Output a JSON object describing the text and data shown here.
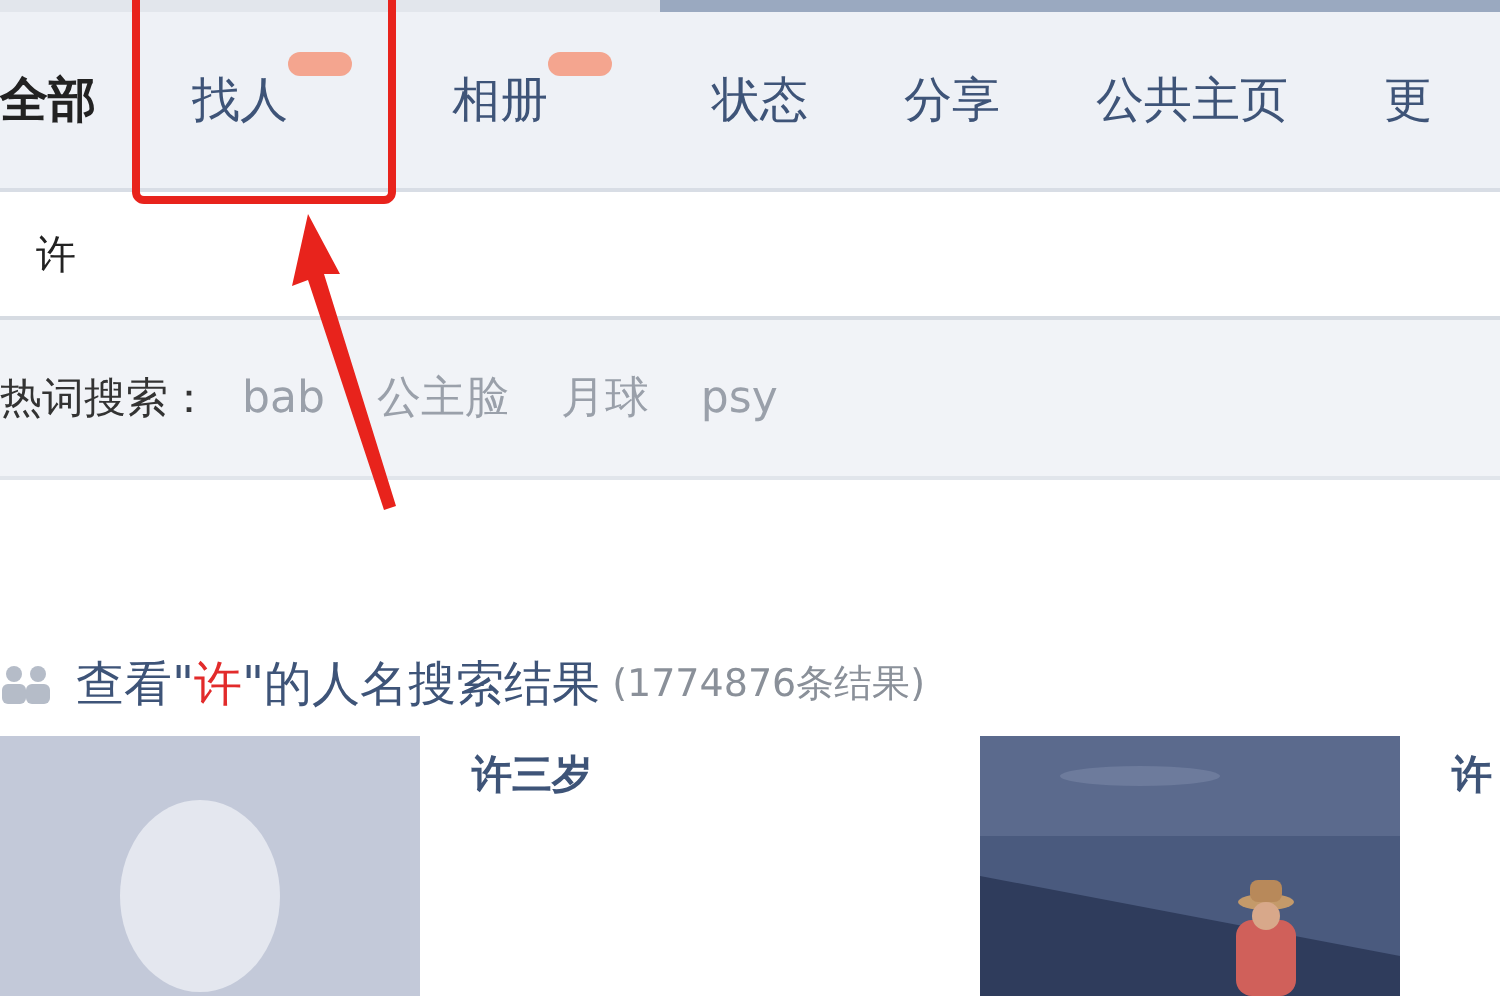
{
  "tabs": [
    {
      "label": "全部",
      "selected": true,
      "new": false,
      "highlighted": false
    },
    {
      "label": "找人",
      "selected": false,
      "new": true,
      "highlighted": true
    },
    {
      "label": "相册",
      "selected": false,
      "new": true,
      "highlighted": false
    },
    {
      "label": "状态",
      "selected": false,
      "new": false,
      "highlighted": false
    },
    {
      "label": "分享",
      "selected": false,
      "new": false,
      "highlighted": false
    },
    {
      "label": "公共主页",
      "selected": false,
      "new": false,
      "highlighted": false
    },
    {
      "label": "更",
      "selected": false,
      "new": false,
      "highlighted": false
    }
  ],
  "search": {
    "value": "许"
  },
  "hot_words": {
    "label": "热词搜索：",
    "words": [
      "bab",
      "公主脸",
      "月球",
      "psy"
    ]
  },
  "results_heading": {
    "prefix": "查看\"",
    "query": "许",
    "suffix": "\"的人名搜索结果",
    "count": "(1774876条结果)"
  },
  "results": [
    {
      "kind": "default-avatar",
      "name": "许三岁"
    },
    {
      "kind": "picture",
      "name": "许"
    }
  ]
}
